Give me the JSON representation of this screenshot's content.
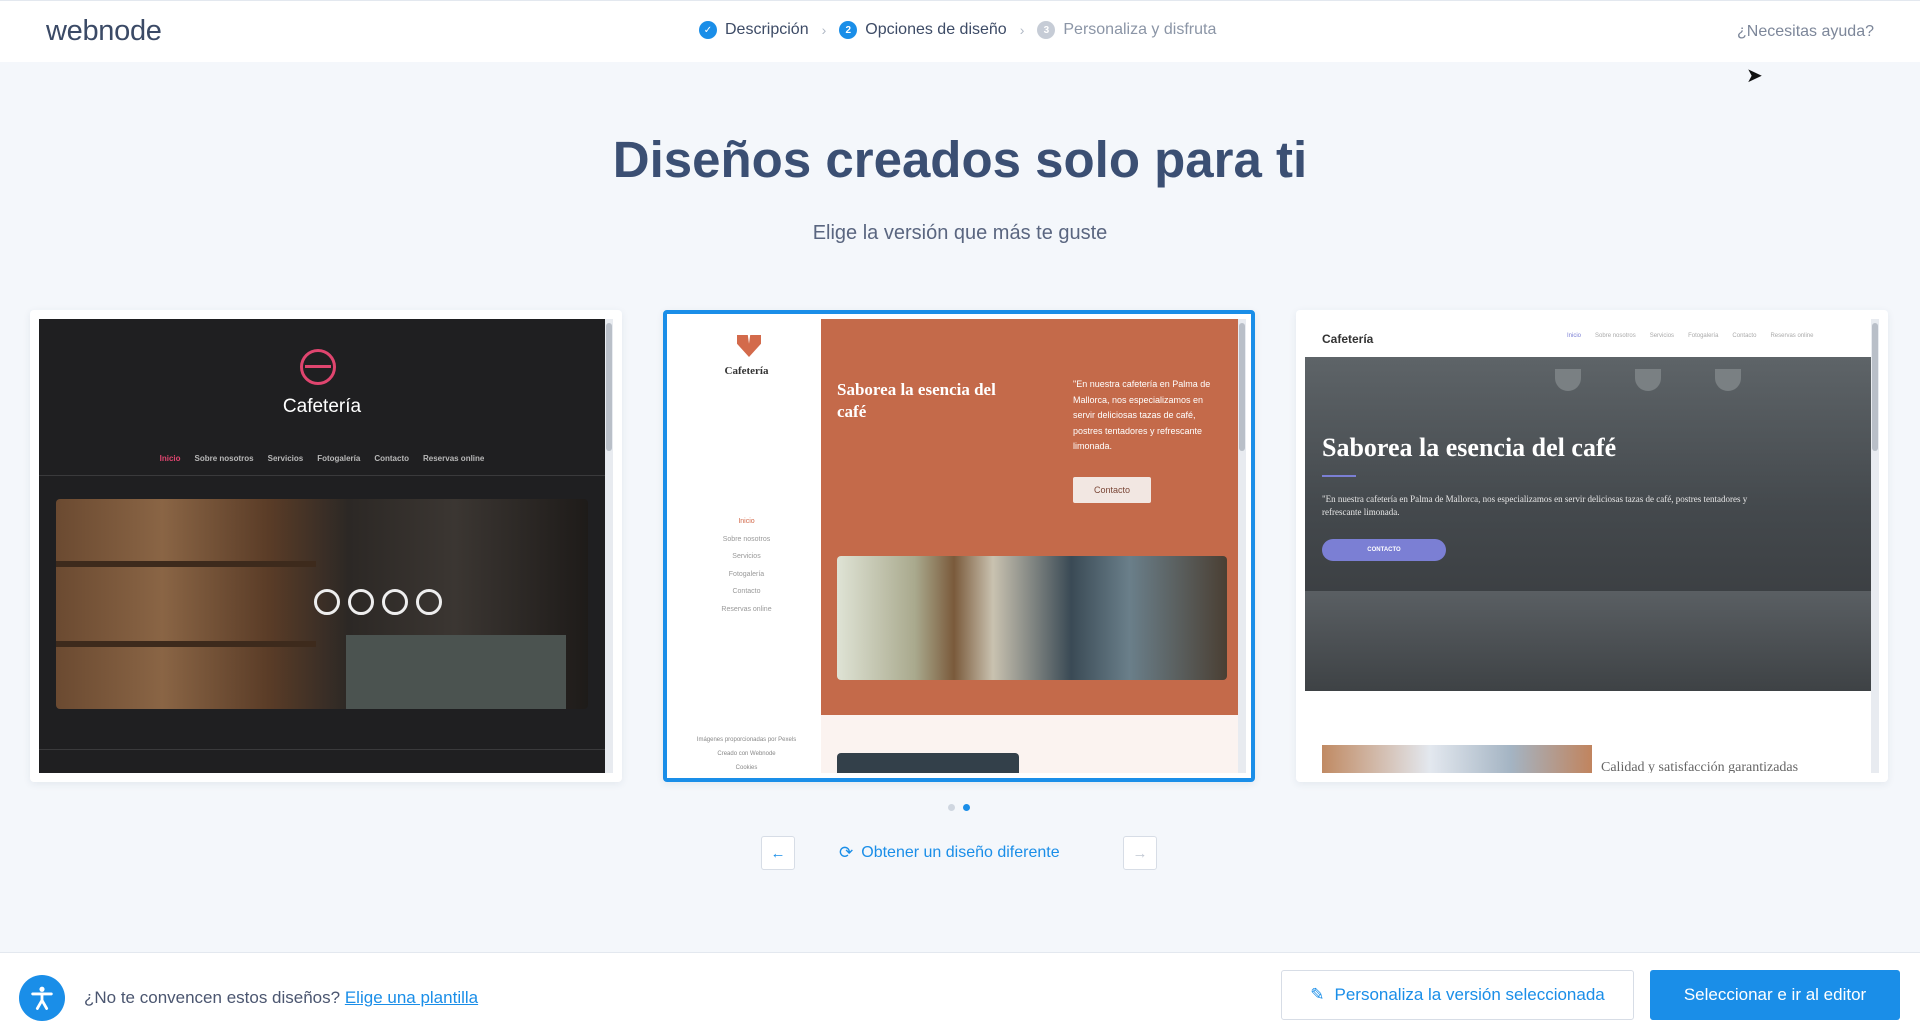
{
  "header": {
    "logo": "webnode",
    "steps": [
      {
        "label": "Descripción",
        "marker": "✓"
      },
      {
        "label": "Opciones de diseño",
        "marker": "2"
      },
      {
        "label": "Personaliza y disfruta",
        "marker": "3"
      }
    ],
    "help": "¿Necesitas ayuda?"
  },
  "hero": {
    "title": "Diseños creados solo para ti",
    "subtitle": "Elige la versión que más te guste"
  },
  "cards": [
    {
      "brand": "Cafetería",
      "nav": [
        "Inicio",
        "Sobre nosotros",
        "Servicios",
        "Fotogalería",
        "Contacto",
        "Reservas online"
      ]
    },
    {
      "brand": "Cafetería",
      "nav": [
        "Inicio",
        "Sobre nosotros",
        "Servicios",
        "Fotogalería",
        "Contacto",
        "Reservas online"
      ],
      "headline": "Saborea la esencia del café",
      "quote": "\"En nuestra cafetería en Palma de Mallorca, nos especializamos en servir deliciosas tazas de café, postres tentadores y refrescante limonada.",
      "button": "Contacto",
      "footer_lines": [
        "Imágenes proporcionadas por Pexels",
        "Creado con Webnode",
        "Cookies"
      ]
    },
    {
      "brand": "Cafetería",
      "nav": [
        "Inicio",
        "Sobre nosotros",
        "Servicios",
        "Fotogalería",
        "Contacto",
        "Reservas online"
      ],
      "headline": "Saborea la esencia del café",
      "description": "\"En nuestra cafetería en Palma de Mallorca, nos especializamos en servir deliciosas tazas de café, postres tentadores y refrescante limonada.",
      "button": "CONTACTO",
      "tagline": "Calidad y satisfacción garantizadas"
    }
  ],
  "pager": {
    "refresh_label": "Obtener un diseño diferente",
    "prev_icon": "←",
    "next_icon": "→",
    "refresh_icon": "⟳"
  },
  "footer": {
    "question": "¿No te convencen estos diseños?",
    "template_link": "Elige una plantilla",
    "customize_button": "Personaliza la versión seleccionada",
    "customize_icon": "✎",
    "select_button": "Seleccionar e ir al editor"
  },
  "colors": {
    "accent": "#1a8ee8",
    "title": "#3b4f73",
    "card2_hero": "#c46a4a",
    "card3_accent": "#7b7fd4",
    "card1_accent": "#e0456f"
  }
}
